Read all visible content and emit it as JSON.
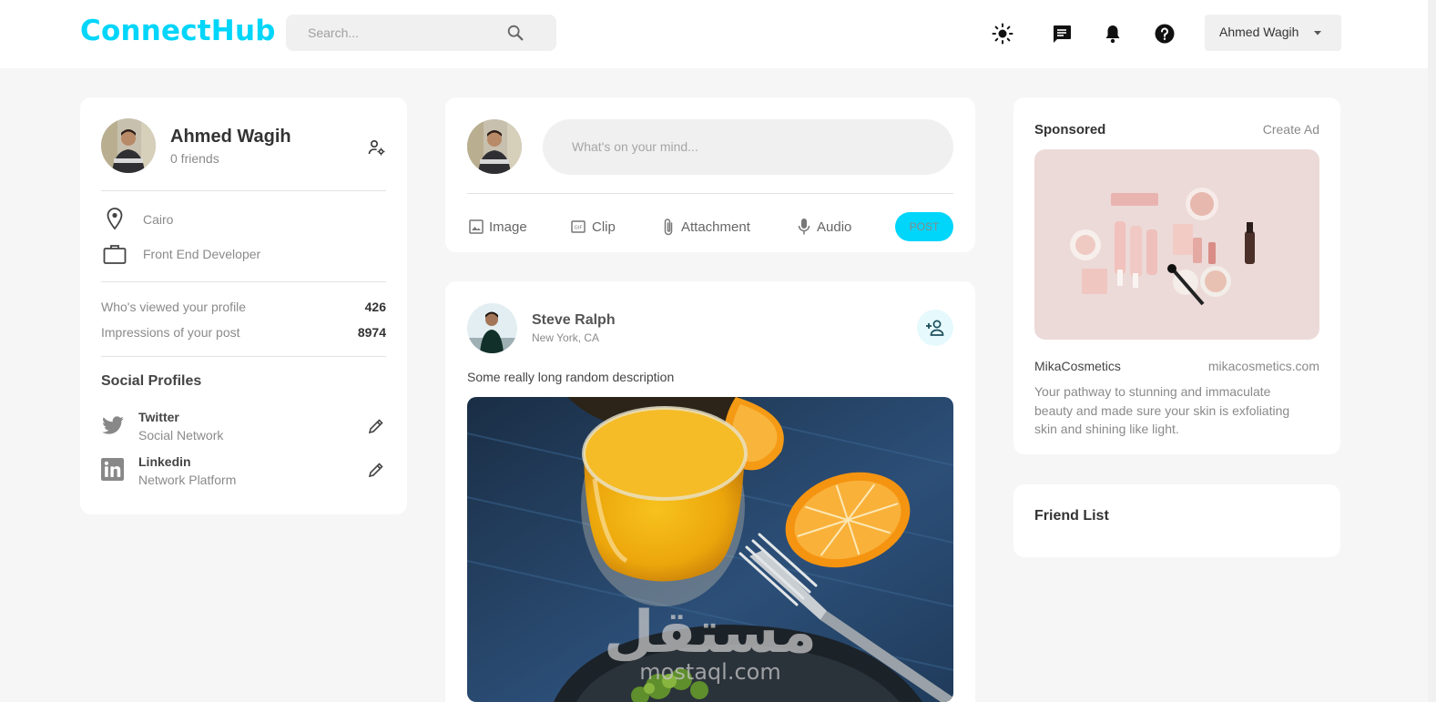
{
  "navbar": {
    "logo": "ConnectHub",
    "search_placeholder": "Search...",
    "user_name": "Ahmed Wagih"
  },
  "profile": {
    "name": "Ahmed Wagih",
    "friends": "0 friends",
    "location": "Cairo",
    "occupation": "Front End Developer",
    "stats": [
      {
        "label": "Who's viewed your profile",
        "value": "426"
      },
      {
        "label": "Impressions of your post",
        "value": "8974"
      }
    ],
    "social_title": "Social Profiles",
    "socials": [
      {
        "name": "Twitter",
        "type": "Social Network"
      },
      {
        "name": "Linkedin",
        "type": "Network Platform"
      }
    ]
  },
  "composer": {
    "placeholder": "What's on your mind...",
    "actions": {
      "image": "Image",
      "clip": "Clip",
      "attachment": "Attachment",
      "audio": "Audio"
    },
    "post_button": "POST"
  },
  "post": {
    "author": "Steve Ralph",
    "location": "New York, CA",
    "description": "Some really long random description"
  },
  "sponsored": {
    "title": "Sponsored",
    "create_ad": "Create Ad",
    "brand": "MikaCosmetics",
    "url": "mikacosmetics.com",
    "text": "Your pathway to stunning and immaculate beauty and made sure your skin is exfoliating skin and shining like light."
  },
  "friend_list": {
    "title": "Friend List"
  },
  "watermark": {
    "text": "مستقل",
    "subtext": "mostaql.com"
  },
  "colors": {
    "accent": "#00d5fa",
    "background": "#f6f6f6",
    "card": "#ffffff"
  }
}
